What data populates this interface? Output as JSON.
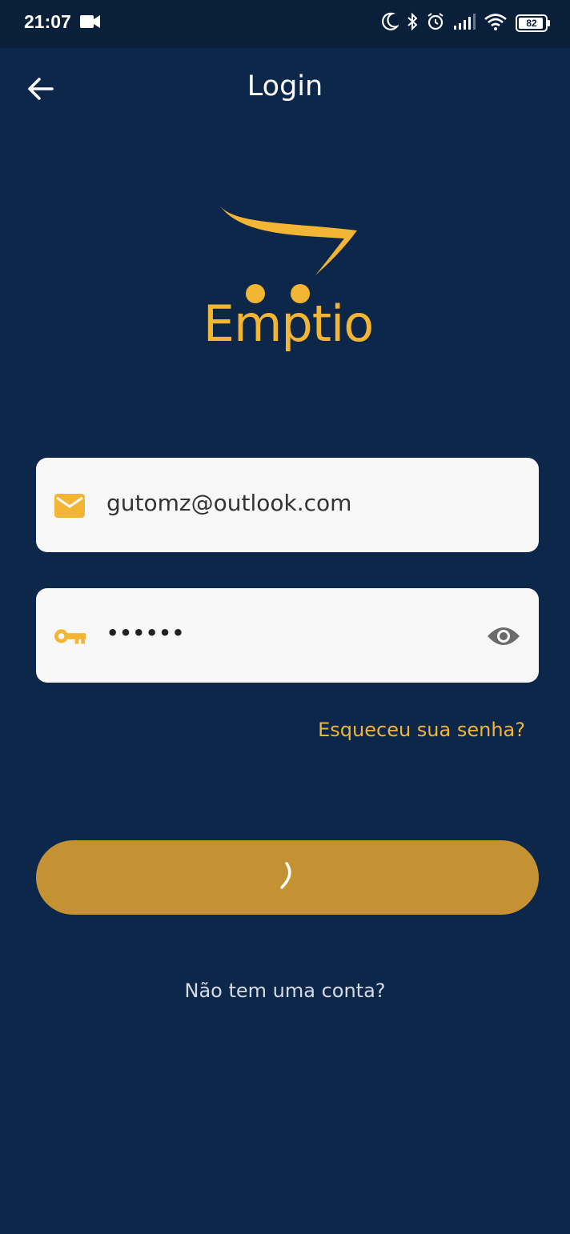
{
  "status_bar": {
    "time": "21:07",
    "battery": "82",
    "icons": [
      "camera-icon",
      "moon-icon",
      "bluetooth-icon",
      "alarm-icon",
      "signal-icon",
      "wifi-icon",
      "battery-icon"
    ]
  },
  "app_bar": {
    "title": "Login",
    "back_icon": "arrow-left-icon"
  },
  "logo": {
    "text": "Emptio",
    "color": "#f2b534"
  },
  "form": {
    "email": {
      "value": "gutomz@outlook.com",
      "icon": "mail-icon"
    },
    "password": {
      "value": "••••••",
      "icon": "key-icon",
      "toggle_icon": "eye-icon"
    },
    "forgot_label": "Esqueceu sua senha?",
    "submit_state": "loading",
    "signup_label": "Não tem uma conta?"
  },
  "colors": {
    "background": "#0c2749",
    "accent": "#f2b534",
    "button": "#c49233",
    "field": "#f8f8f9"
  }
}
